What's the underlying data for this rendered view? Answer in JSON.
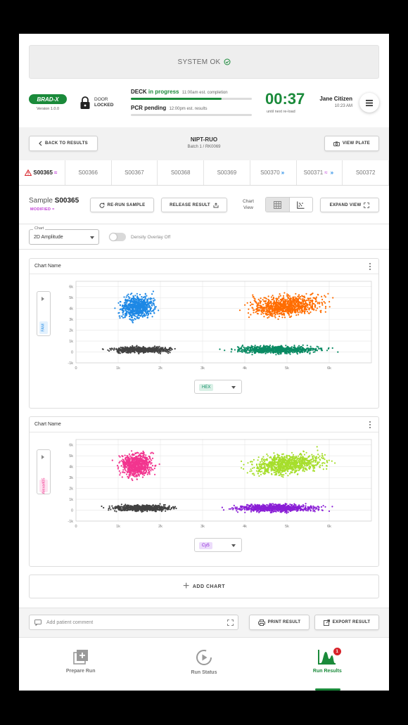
{
  "system": {
    "status": "SYSTEM OK"
  },
  "header": {
    "logo": "BRAD-X",
    "version": "Version 1.0.0",
    "door": {
      "label": "DOOR",
      "state": "LOCKED"
    },
    "deck": {
      "label": "DECK",
      "state": "in progress",
      "detail": "11:00am est. completion",
      "progress": 0.75
    },
    "pcr": {
      "label": "PCR pending",
      "detail": "12:00pm est. results",
      "progress": 0
    },
    "timer": "00:37",
    "timer_sub": "until next re-load",
    "user": {
      "name": "Jane Citizen",
      "time": "10:23 AM"
    }
  },
  "run_bar": {
    "back_label": "BACK TO RESULTS",
    "title": "NIPT-RUO",
    "subtitle": "Batch 1 / RK0069",
    "view_plate_label": "VIEW PLATE"
  },
  "tabs": [
    {
      "label": "S00365",
      "warning": true,
      "modified": true,
      "active": true
    },
    {
      "label": "S00366"
    },
    {
      "label": "S00367"
    },
    {
      "label": "S00368"
    },
    {
      "label": "S00369"
    },
    {
      "label": "S00370",
      "rerun": true
    },
    {
      "label": "S00371",
      "modified": true,
      "rerun": true
    },
    {
      "label": "S00372"
    }
  ],
  "sample": {
    "prefix": "Sample",
    "id": "S00365",
    "modified_label": "MODIFIED",
    "rerun_label": "RE-RUN SAMPLE",
    "release_label": "RELEASE RESULT",
    "chart_view_label_1": "Chart",
    "chart_view_label_2": "View",
    "expand_label": "EXPAND VIEW"
  },
  "controls": {
    "chart_field_label": "Chart",
    "chart_value": "2D Amplitude",
    "density_label": "Density Overlay Off"
  },
  "icons": [
    "check-circle-icon",
    "lock-icon",
    "hamburger-menu-icon",
    "chevron-left-icon",
    "camera-icon",
    "warning-icon",
    "modified-icon",
    "double-chevron-icon",
    "refresh-icon",
    "release-icon",
    "table-view-icon",
    "scatter-view-icon",
    "expand-icon",
    "kebab-menu-icon",
    "print-icon",
    "export-icon",
    "prepare-run-icon",
    "run-status-icon",
    "run-results-icon"
  ],
  "colors": {
    "brand_green": "#1a8a3a",
    "warning_red": "#d8232a",
    "modified_purple": "#c03bd6"
  },
  "chart_data": [
    {
      "type": "scatter",
      "title": "Chart Name",
      "xlabel": "HEX",
      "ylabel": "FAM",
      "xlim": [
        0,
        7000
      ],
      "ylim": [
        -1000,
        6500
      ],
      "x_ticks": [
        "0",
        "1k",
        "2k",
        "3k",
        "4k",
        "5k",
        "6k"
      ],
      "y_ticks": [
        "-1k",
        "0",
        "1k",
        "2k",
        "3k",
        "4k",
        "5k",
        "6k"
      ],
      "grid": true,
      "series": [
        {
          "color": "#1e88e5",
          "x_range": [
            700,
            2100
          ],
          "y_range": [
            2200,
            6100
          ],
          "points": 700
        },
        {
          "color": "#ff6d00",
          "x_range": [
            3500,
            6500
          ],
          "y_range": [
            2600,
            5900
          ],
          "points": 900
        },
        {
          "color": "#424242",
          "x_range": [
            300,
            2800
          ],
          "y_range": [
            -300,
            700
          ],
          "points": 600
        },
        {
          "color": "#0a8a63",
          "x_range": [
            3000,
            6500
          ],
          "y_range": [
            -400,
            800
          ],
          "points": 800
        }
      ]
    },
    {
      "type": "scatter",
      "title": "Chart Name",
      "xlabel": "Cy5",
      "ylabel": "Alexa405",
      "xlim": [
        0,
        7000
      ],
      "ylim": [
        -1000,
        6500
      ],
      "x_ticks": [
        "0",
        "1k",
        "2k",
        "3k",
        "4k",
        "5k",
        "6k"
      ],
      "y_ticks": [
        "-1k",
        "0",
        "1k",
        "2k",
        "3k",
        "4k",
        "5k",
        "6k"
      ],
      "grid": true,
      "series": [
        {
          "color": "#f2358f",
          "x_range": [
            700,
            2100
          ],
          "y_range": [
            2200,
            6100
          ],
          "points": 700
        },
        {
          "color": "#a6de2c",
          "x_range": [
            3500,
            6500
          ],
          "y_range": [
            2600,
            5900
          ],
          "points": 900
        },
        {
          "color": "#424242",
          "x_range": [
            300,
            2800
          ],
          "y_range": [
            -300,
            700
          ],
          "points": 600
        },
        {
          "color": "#8a1fd6",
          "x_range": [
            3000,
            6500
          ],
          "y_range": [
            -400,
            800
          ],
          "points": 800
        }
      ]
    }
  ],
  "add_chart_label": "ADD CHART",
  "footer": {
    "comment_placeholder": "Add patient comment",
    "print_label": "PRINT RESULT",
    "export_label": "EXPORT RESULT"
  },
  "nav": [
    {
      "label": "Prepare Run"
    },
    {
      "label": "Run Status"
    },
    {
      "label": "Run Results",
      "badge": "1",
      "active": true
    }
  ]
}
